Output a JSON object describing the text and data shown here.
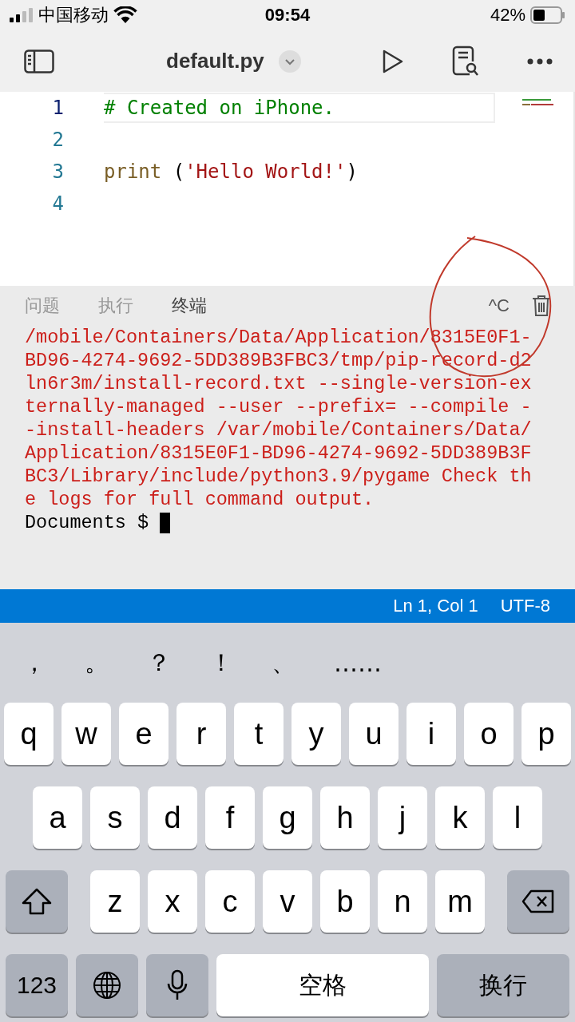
{
  "status_bar": {
    "carrier": "中国移动",
    "time": "09:54",
    "battery": "42%"
  },
  "toolbar": {
    "file_name": "default.py"
  },
  "editor": {
    "lines": [
      {
        "number": "1",
        "current": true,
        "tokens": [
          {
            "kind": "comment",
            "text": "# Created on iPhone."
          }
        ]
      },
      {
        "number": "2",
        "current": false
      },
      {
        "number": "3",
        "current": false,
        "tokens": [
          {
            "kind": "function",
            "text": "print"
          },
          {
            "kind": "plain",
            "text": " ("
          },
          {
            "kind": "string",
            "text": "'Hello World!'"
          },
          {
            "kind": "plain",
            "text": ")"
          }
        ]
      },
      {
        "number": "4",
        "current": false
      }
    ]
  },
  "panel": {
    "tabs": [
      {
        "label": "问题",
        "selected": false
      },
      {
        "label": "执行",
        "selected": false
      },
      {
        "label": "终端",
        "selected": true
      }
    ],
    "interrupt": "^C",
    "output": [
      "/mobile/Containers/Data/Application/8315E0F1-",
      "BD96-4274-9692-5DD389B3FBC3/tmp/pip-record-d2",
      "ln6r3m/install-record.txt --single-version-ex",
      "ternally-managed --user --prefix= --compile -",
      "-install-headers /var/mobile/Containers/Data/",
      "Application/8315E0F1-BD96-4274-9692-5DD389B3F",
      "BC3/Library/include/python3.9/pygame Check th",
      "e logs for full command output."
    ],
    "prompt": "Documents $"
  },
  "editor_status": {
    "position": "Ln 1, Col 1",
    "encoding": "UTF-8"
  },
  "keyboard": {
    "candidates": [
      "，",
      "。",
      "？",
      "！",
      "、",
      "……"
    ],
    "letter_rows": [
      {
        "keys": [
          "q",
          "w",
          "e",
          "r",
          "t",
          "y",
          "u",
          "i",
          "o",
          "p"
        ]
      },
      {
        "keys": [
          "a",
          "s",
          "d",
          "f",
          "g",
          "h",
          "j",
          "k",
          "l"
        ]
      },
      {
        "keys": [
          "z",
          "x",
          "c",
          "v",
          "b",
          "n",
          "m"
        ]
      }
    ],
    "numbers_key": "123",
    "space_key": "空格",
    "return_key": "换行"
  }
}
